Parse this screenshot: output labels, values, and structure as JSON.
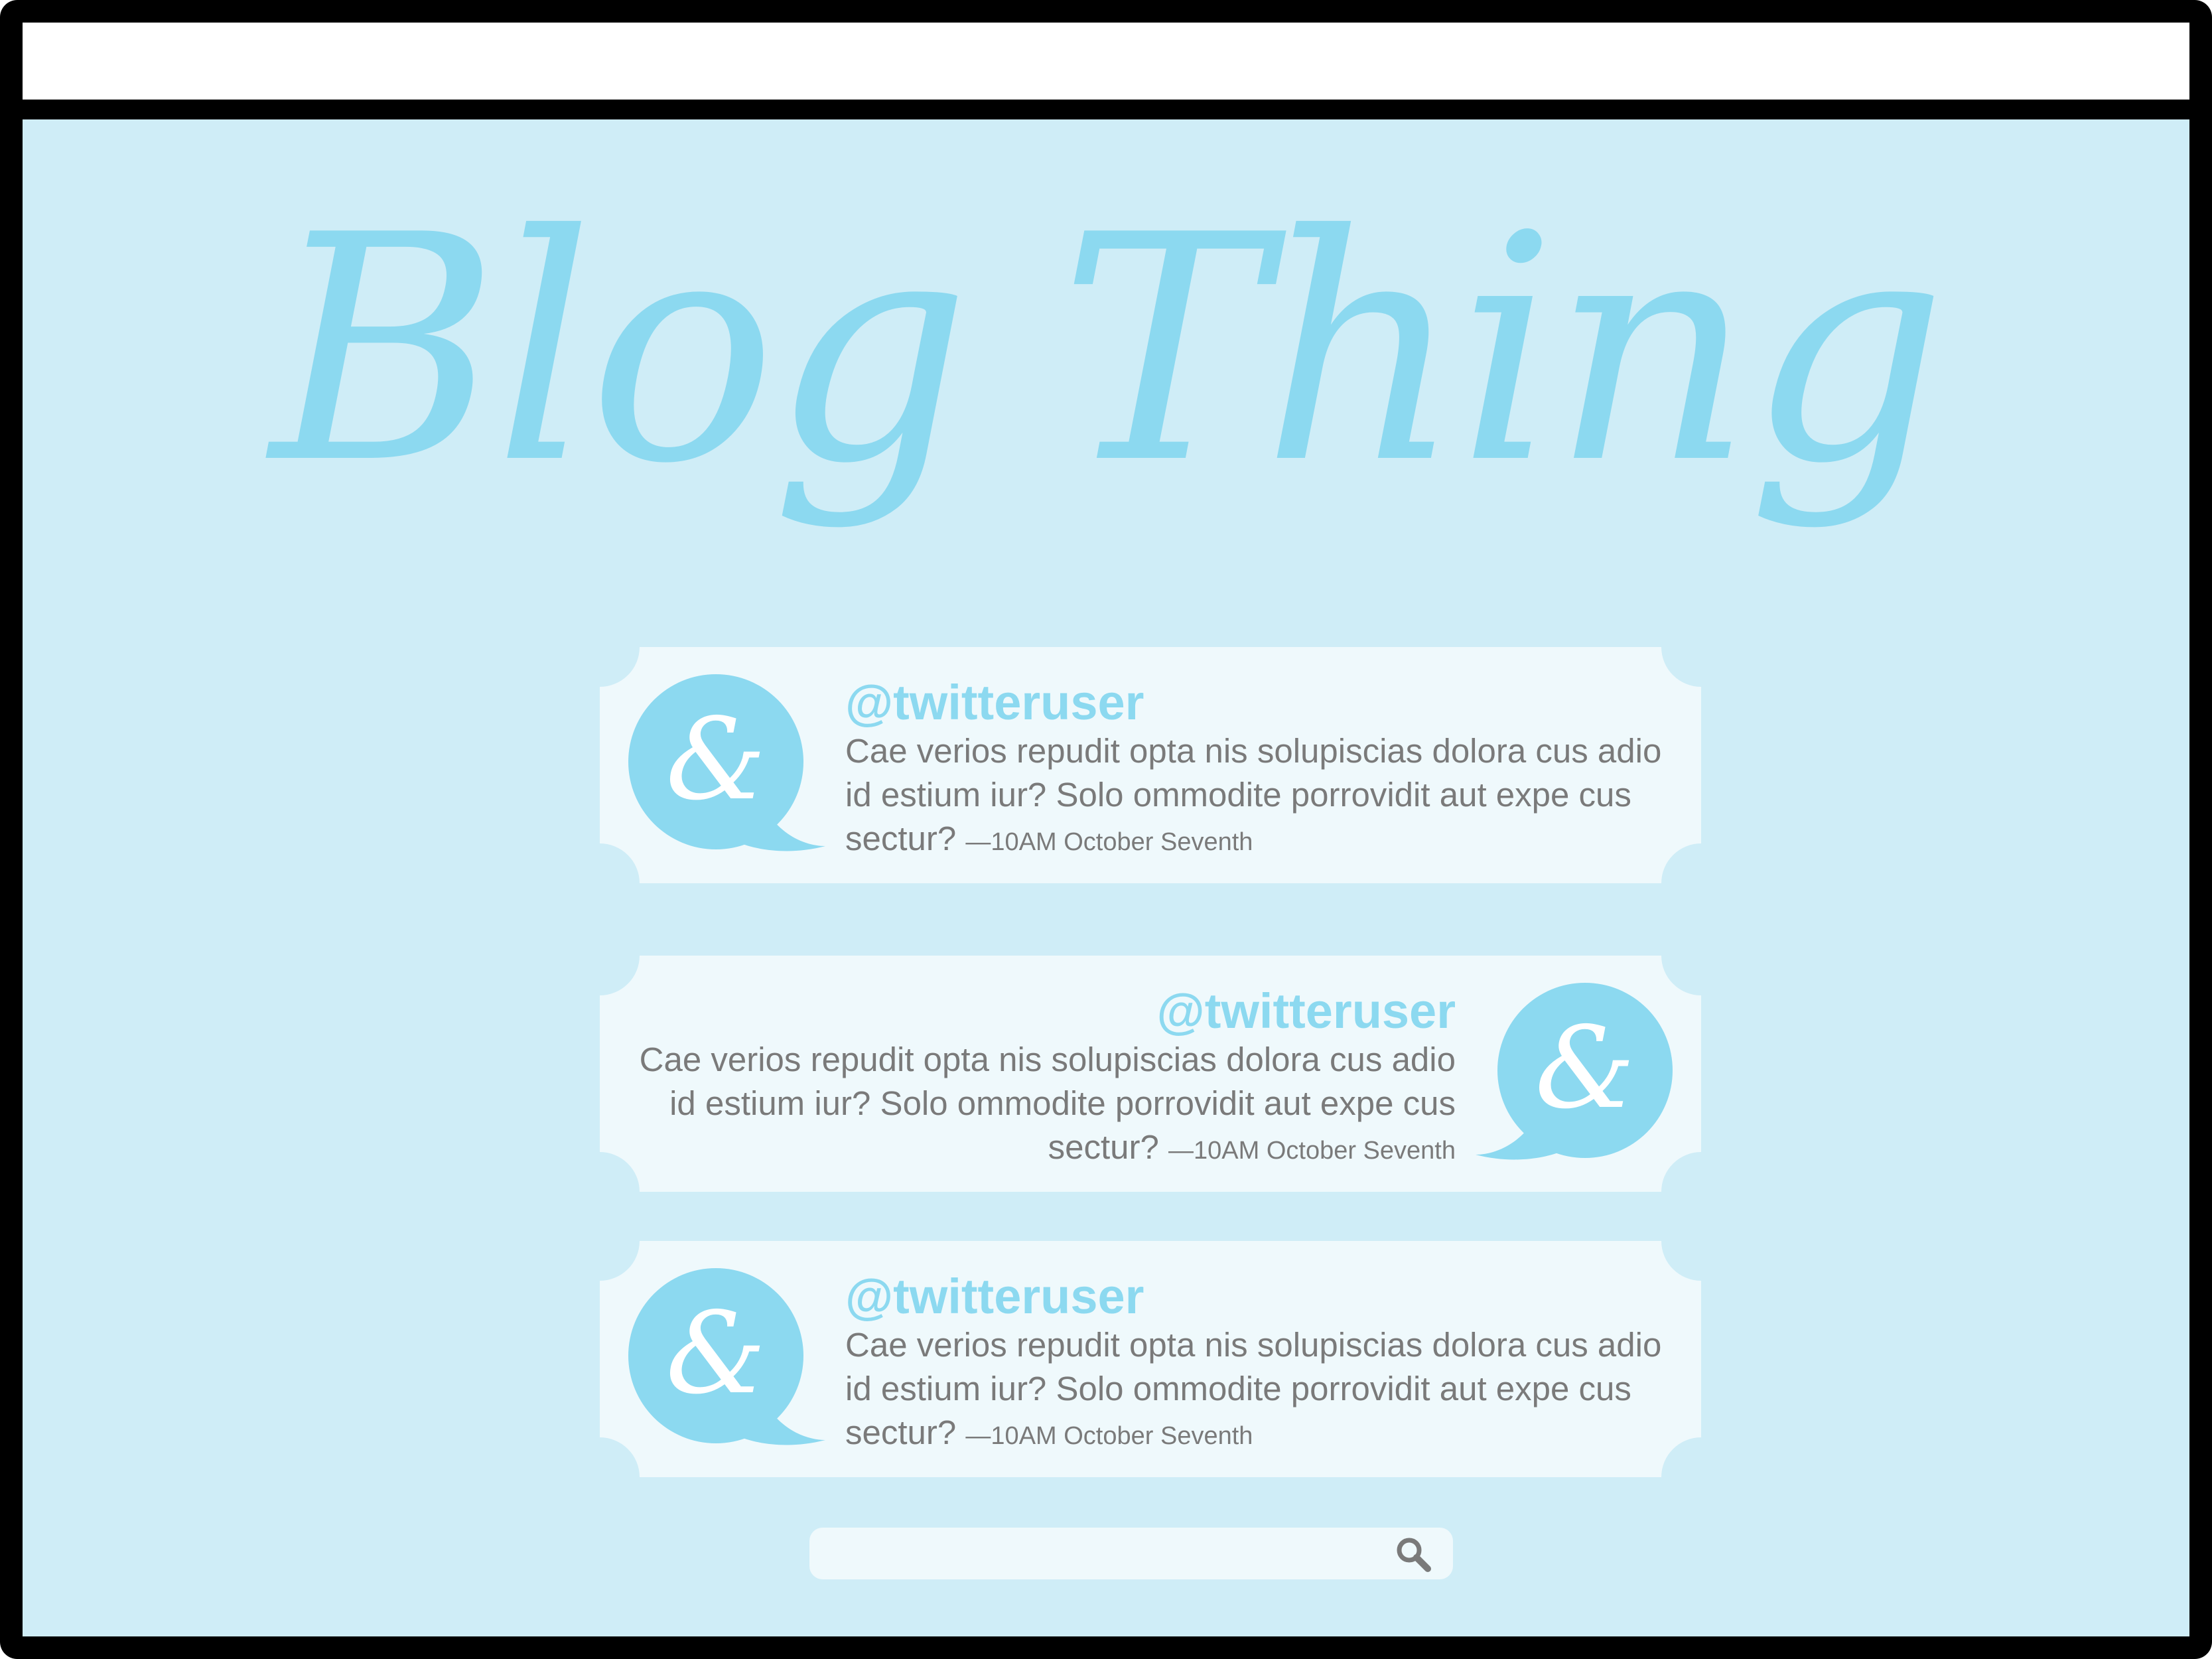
{
  "site": {
    "title": "Blog Thing"
  },
  "colors": {
    "page_background": "#cfedf7",
    "card_background": "#eff9fc",
    "accent": "#8cd9f0",
    "text_gray": "#7a7a7a",
    "frame": "#000000"
  },
  "tweets": [
    {
      "username": "@twitteruser",
      "body": "Cae verios repudit opta nis solupiscias dolora cus adio id estium iur? Solo ommodite porrovidit aut expe cus sectur?",
      "timestamp": "—10AM October Seventh",
      "avatar_icon": "ampersand-speech-bubble-icon",
      "avatar_side": "left"
    },
    {
      "username": "@twitteruser",
      "body": "Cae verios repudit opta nis solupiscias dolora cus adio id estium iur? Solo ommodite porrovidit aut expe cus sectur?",
      "timestamp": "—10AM October Seventh",
      "avatar_icon": "ampersand-speech-bubble-icon",
      "avatar_side": "right"
    },
    {
      "username": "@twitteruser",
      "body": "Cae verios repudit opta nis solupiscias dolora cus adio id estium iur? Solo ommodite porrovidit aut expe cus sectur?",
      "timestamp": "—10AM October Seventh",
      "avatar_icon": "ampersand-speech-bubble-icon",
      "avatar_side": "left"
    }
  ],
  "search": {
    "placeholder": "",
    "icon": "magnifier-icon"
  }
}
